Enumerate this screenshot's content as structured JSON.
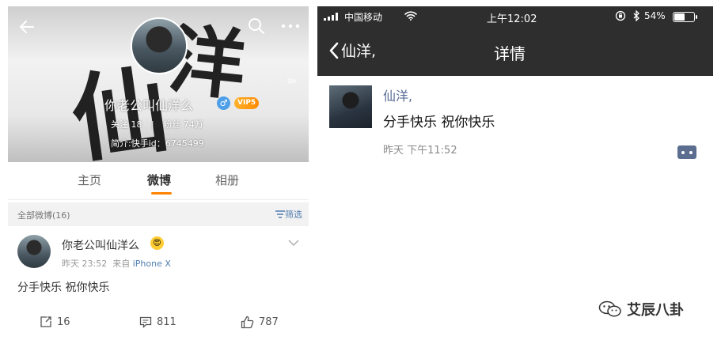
{
  "weibo": {
    "profile": {
      "name": "你老公叫仙洋么",
      "gender_symbol": "♂",
      "vip_label": "VIP5",
      "following_label": "关注",
      "following_count": "18",
      "followers_label": "粉丝",
      "followers_count": "74万",
      "bio": "简介:快手id：6745499"
    },
    "tabs": [
      "主页",
      "微博",
      "相册"
    ],
    "active_tab": "微博",
    "filter_bar": {
      "all_posts": "全部微博(16)",
      "filter_label": "筛选"
    },
    "post": {
      "author": "你老公叫仙洋么",
      "time": "昨天 23:52",
      "source_prefix": "来自",
      "source": "iPhone X",
      "text": "分手快乐 祝你快乐",
      "reposts": "16",
      "comments": "811",
      "likes": "787"
    },
    "accent_color": "#ff8200",
    "link_color": "#507daf"
  },
  "ios": {
    "status_bar": {
      "carrier": "中国移动",
      "time": "上午12:02",
      "battery_pct": "54%",
      "battery_level": 0.54
    },
    "nav": {
      "back_label": "仙洋,",
      "title": "详情"
    },
    "message": {
      "sender": "仙洋,",
      "text": "分手快乐 祝你快乐",
      "time": "昨天 下午11:52"
    },
    "nav_color": "#2e2e2e",
    "name_color": "#576b95"
  },
  "watermark": {
    "text": "艾辰八卦"
  }
}
